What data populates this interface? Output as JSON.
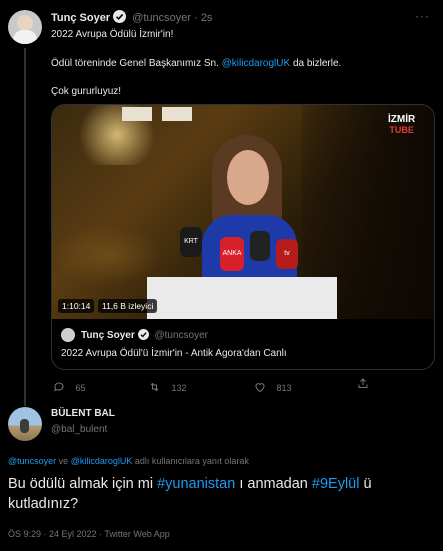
{
  "tweet": {
    "author_name": "Tunç Soyer",
    "handle": "@tuncsoyer",
    "time": "2s",
    "line1": "2022 Avrupa Ödülü İzmir'in!",
    "line2_prefix": "Ödül töreninde Genel Başkanımız Sn.",
    "line2_mention": "@kilicdaroglUK",
    "line2_suffix": "da bizlerle.",
    "line3": "Çok gururluyuz!",
    "video": {
      "logo_line1": "İZMİR",
      "logo_line2": "TUBE",
      "mic_labels": [
        "KRT",
        "ANKA",
        "tv"
      ],
      "time_chip": "1:10:14",
      "views_chip": "11,6 B izleyici"
    },
    "quoted": {
      "author_name": "Tunç Soyer",
      "handle": "@tuncsoyer",
      "text": "2022 Avrupa Ödül'ü İzmir'in - Antik Agora'dan Canlı"
    },
    "stats": {
      "replies": "65",
      "retweets": "132",
      "likes": "813"
    }
  },
  "reply": {
    "author_name": "BÜLENT BAL",
    "handle": "@bal_bulent",
    "reply_to_m1": "@tuncsoyer",
    "reply_to_and": "ve",
    "reply_to_m2": "@kilicdaroglUK",
    "reply_to_suffix": "adlı kullanıcılara yanıt olarak",
    "text_prefix": "Bu ödülü almak için mi",
    "hashtag1": "#yunanistan",
    "text_mid": "ı anmadan",
    "hashtag2": "#9Eylül",
    "text_suffix": "ü",
    "text_line2": "kutladınız?",
    "meta": "ÖS 9:29 · 24 Eyl 2022 · Twitter Web App"
  },
  "colors": {
    "accent": "#1d9bf0",
    "background": "#000000",
    "text": "#e7e9ea",
    "muted": "#71767b"
  }
}
